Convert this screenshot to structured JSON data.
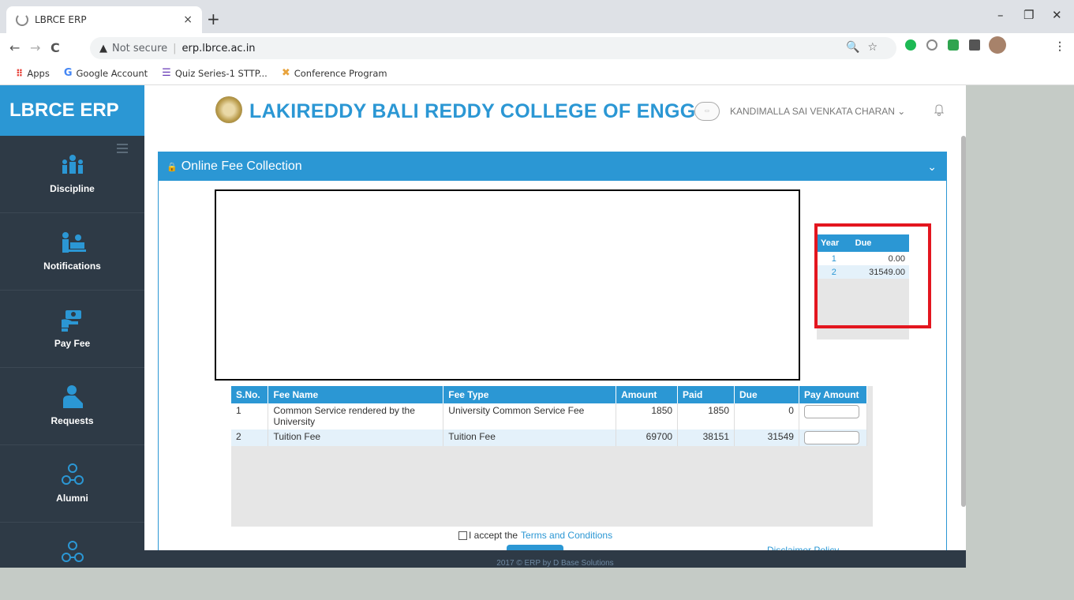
{
  "browser": {
    "tab_title": "LBRCE ERP",
    "tab_close": "×",
    "new_tab": "+",
    "window_controls": {
      "minimize": "–",
      "restore": "❐",
      "close": "✕"
    },
    "nav": {
      "back": "←",
      "forward": "→",
      "reload": "C"
    },
    "security_label": "Not secure",
    "url": "erp.lbrce.ac.in",
    "bookmarks": [
      {
        "label": "Apps",
        "icon": "apps-grid-icon"
      },
      {
        "label": "Google Account",
        "icon": "google-icon"
      },
      {
        "label": "Quiz Series-1 STTP...",
        "icon": "forms-icon"
      },
      {
        "label": "Conference Program",
        "icon": "conference-icon"
      }
    ]
  },
  "app": {
    "brand": "LBRCE ERP",
    "college_name": "LAKIREDDY BALI REDDY COLLEGE OF ENGG",
    "user_name": "KANDIMALLA SAI VENKATA CHARAN ⌄",
    "sidebar": [
      {
        "label": "Discipline",
        "icon": "discipline-icon"
      },
      {
        "label": "Notifications",
        "icon": "notifications-icon"
      },
      {
        "label": "Pay Fee",
        "icon": "pay-fee-icon"
      },
      {
        "label": "Requests",
        "icon": "requests-icon"
      },
      {
        "label": "Alumni",
        "icon": "alumni-icon"
      },
      {
        "label": "",
        "icon": "alumni-icon"
      }
    ],
    "panel": {
      "title": "Online Fee Collection",
      "chevron": "⌄"
    },
    "year_due": {
      "headers": [
        "Year",
        "Due"
      ],
      "rows": [
        {
          "year": "1",
          "due": "0.00"
        },
        {
          "year": "2",
          "due": "31549.00"
        }
      ]
    },
    "fees": {
      "headers": [
        "S.No.",
        "Fee Name",
        "Fee Type",
        "Amount",
        "Paid",
        "Due",
        "Pay Amount"
      ],
      "rows": [
        {
          "sno": "1",
          "name": "Common Service rendered by the University",
          "type": "University Common Service Fee",
          "amount": "1850",
          "paid": "1850",
          "due": "0",
          "pay": ""
        },
        {
          "sno": "2",
          "name": "Tuition Fee",
          "type": "Tuition Fee",
          "amount": "69700",
          "paid": "38151",
          "due": "31549",
          "pay": ""
        }
      ]
    },
    "terms": {
      "prefix": "I accept the",
      "link": "Terms and Conditions"
    },
    "disclaimer": "Disclaimer Policy",
    "footer": "2017 © ERP by D Base Solutions"
  }
}
